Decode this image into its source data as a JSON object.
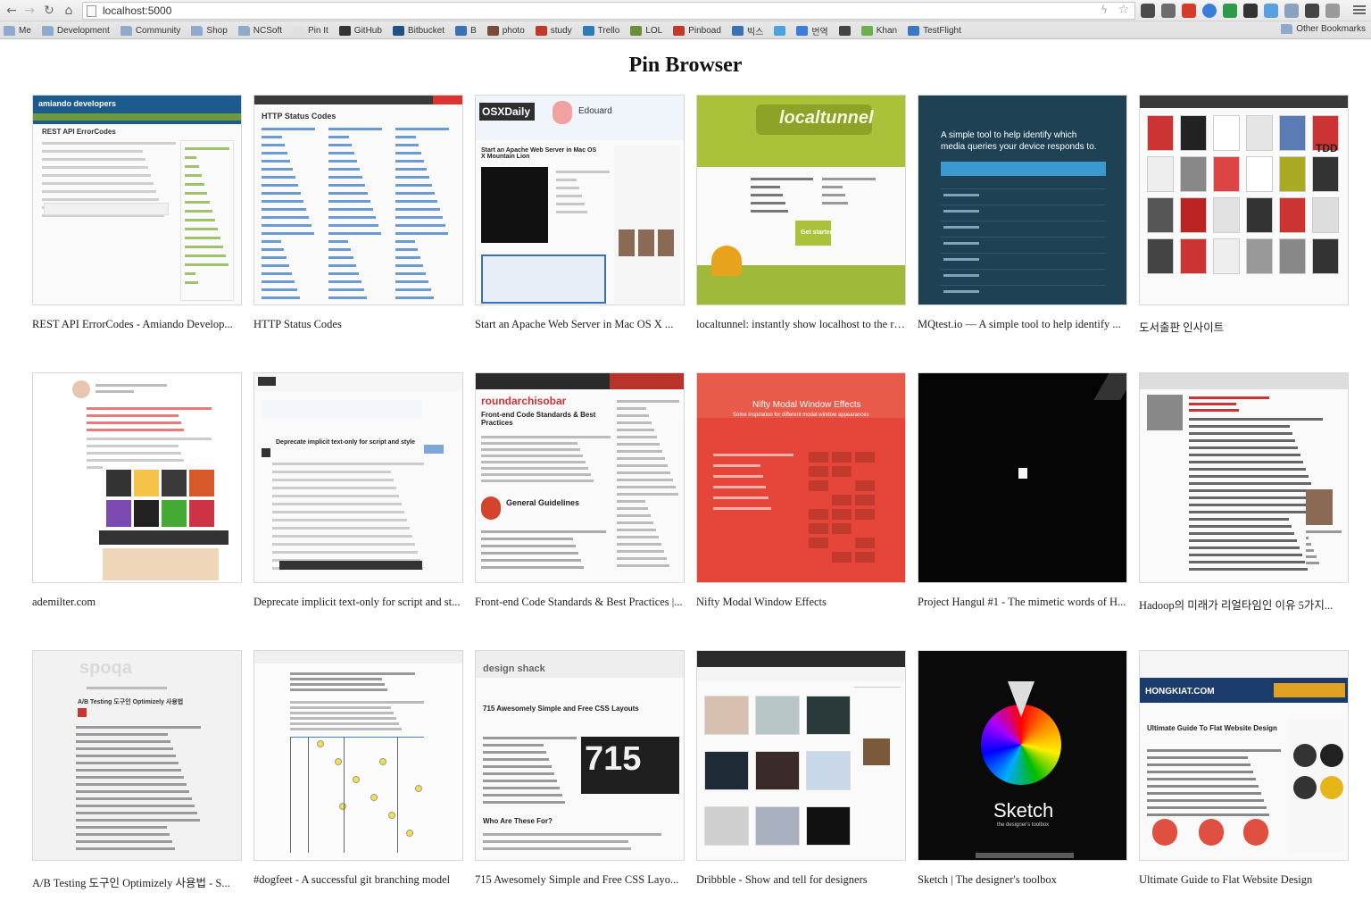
{
  "browser": {
    "url": "localhost:5000",
    "bookmarks": [
      {
        "label": "Me",
        "icon": "folder-icon"
      },
      {
        "label": "Development",
        "icon": "folder-icon"
      },
      {
        "label": "Community",
        "icon": "folder-icon"
      },
      {
        "label": "Shop",
        "icon": "folder-icon"
      },
      {
        "label": "NCSoft",
        "icon": "folder-icon"
      },
      {
        "label": "Pin It",
        "icon": "page-icon"
      },
      {
        "label": "GitHub",
        "icon": "github-icon"
      },
      {
        "label": "Bitbucket",
        "icon": "bitbucket-icon"
      },
      {
        "label": "B",
        "icon": "bookmark-icon"
      },
      {
        "label": "photo",
        "icon": "photo-icon"
      },
      {
        "label": "study",
        "icon": "study-icon"
      },
      {
        "label": "Trello",
        "icon": "trello-icon"
      },
      {
        "label": "LOL",
        "icon": "lol-icon"
      },
      {
        "label": "Pinboad",
        "icon": "pinboard-icon"
      },
      {
        "label": "빅스",
        "icon": "bookmark-icon"
      },
      {
        "label": "",
        "icon": "twitter-icon"
      },
      {
        "label": "번역",
        "icon": "translate-icon"
      },
      {
        "label": "",
        "icon": "camera-icon"
      },
      {
        "label": "Khan",
        "icon": "khan-icon"
      },
      {
        "label": "TestFlight",
        "icon": "testflight-icon"
      }
    ],
    "other_bookmarks": "Other Bookmarks",
    "colors": {
      "folder": "#8ea9c9"
    }
  },
  "page": {
    "title": "Pin Browser"
  },
  "pins": [
    {
      "caption": "REST API ErrorCodes - Amiando Develop...",
      "thumb": {
        "heading": "REST API ErrorCodes",
        "brand": "amiando developers"
      }
    },
    {
      "caption": "HTTP Status Codes",
      "thumb": {
        "heading": "HTTP Status Codes"
      }
    },
    {
      "caption": "Start an Apache Web Server in Mac OS X ...",
      "thumb": {
        "heading": "Start an Apache Web Server in Mac OS X Mountain Lion",
        "brand": "OSXDaily",
        "sub": "Edouard"
      }
    },
    {
      "caption": "localtunnel: instantly show localhost to the re...",
      "thumb": {
        "brand": "localtunnel",
        "sub": "Get started"
      }
    },
    {
      "caption": "MQtest.io — A simple tool to help identify ...",
      "thumb": {
        "heading": "A simple tool to help identify which media queries your device responds to."
      }
    },
    {
      "caption": "도서출판 인사이트",
      "thumb": {
        "sub": "TDD"
      }
    },
    {
      "caption": "ademilter.com",
      "thumb": {}
    },
    {
      "caption": "Deprecate implicit text-only for script and st...",
      "thumb": {
        "heading": "Deprecate implicit text-only for script and style"
      }
    },
    {
      "caption": "Front-end Code Standards & Best Practices |...",
      "thumb": {
        "brand": "roundarchisobar",
        "heading": "Front-end Code Standards & Best Practices",
        "sub": "General Guidelines"
      }
    },
    {
      "caption": "Nifty Modal Window Effects",
      "thumb": {
        "heading": "Nifty Modal Window Effects",
        "sub": "Some inspiration for different modal window appearances"
      }
    },
    {
      "caption": "Project Hangul #1 - The mimetic words of H...",
      "thumb": {}
    },
    {
      "caption": "Hadoop의 미래가 리얼타임인 이유 5가지...",
      "thumb": {}
    },
    {
      "caption": "A/B Testing 도구인 Optimizely 사용법 - S...",
      "thumb": {
        "brand": "spoqa",
        "heading": "A/B Testing 도구인 Optimizely 사용법"
      }
    },
    {
      "caption": "#dogfeet - A successful git branching model",
      "thumb": {}
    },
    {
      "caption": "715 Awesomely Simple and Free CSS Layo...",
      "thumb": {
        "brand": "design shack",
        "heading": "715 Awesomely Simple and Free CSS Layouts",
        "sub": "Who Are These For?",
        "badge": "715"
      }
    },
    {
      "caption": "Dribbble - Show and tell for designers",
      "thumb": {}
    },
    {
      "caption": "Sketch | The designer's toolbox",
      "thumb": {
        "brand": "Sketch",
        "sub": "the designer's toolbox"
      }
    },
    {
      "caption": "Ultimate Guide to Flat Website Design",
      "thumb": {
        "brand": "HONGKIAT.COM",
        "heading": "Ultimate Guide To Flat Website Design"
      }
    }
  ]
}
